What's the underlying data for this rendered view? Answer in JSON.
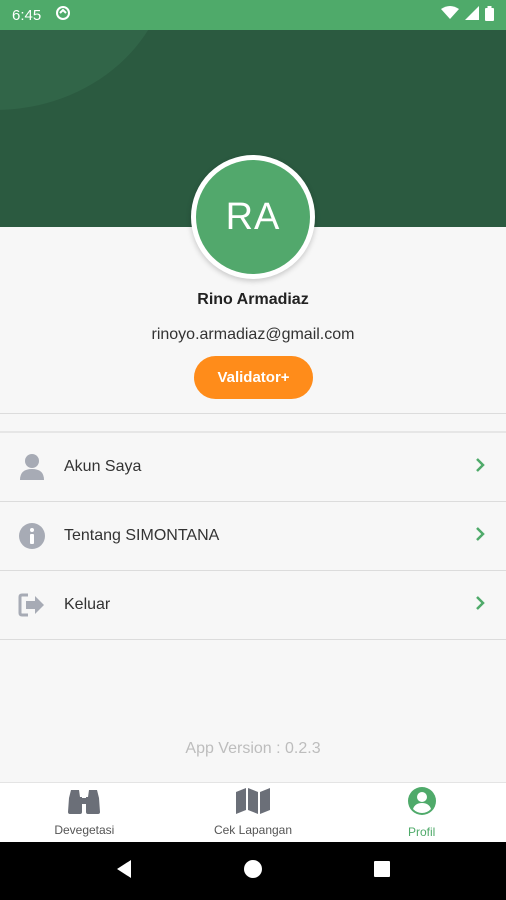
{
  "status_bar": {
    "time": "6:45"
  },
  "profile": {
    "initials": "RA",
    "name": "Rino Armadiaz",
    "email": "rinoyo.armadiaz@gmail.com",
    "role": "Validator+"
  },
  "menu": {
    "items": [
      {
        "label": "Akun Saya",
        "icon": "user-icon"
      },
      {
        "label": "Tentang SIMONTANA",
        "icon": "info-icon"
      },
      {
        "label": "Keluar",
        "icon": "logout-icon"
      }
    ]
  },
  "app_version": "App Version : 0.2.3",
  "bottom_nav": {
    "items": [
      {
        "label": "Devegetasi",
        "icon": "binoculars-icon",
        "active": false
      },
      {
        "label": "Cek Lapangan",
        "icon": "map-icon",
        "active": false
      },
      {
        "label": "Profil",
        "icon": "profile-icon",
        "active": true
      }
    ]
  },
  "colors": {
    "primary": "#4faa6a",
    "header": "#2b5a40",
    "accent": "#ff8c1a"
  }
}
